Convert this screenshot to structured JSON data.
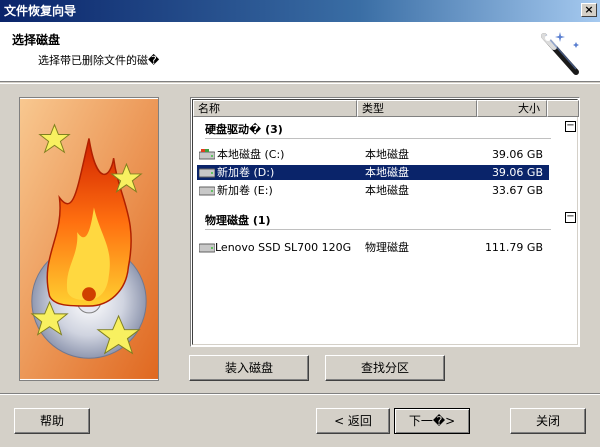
{
  "window": {
    "title": "文件恢复向导",
    "close_glyph": "×"
  },
  "header": {
    "title": "选择磁盘",
    "subtitle": "选择带已删除文件的磁�"
  },
  "list": {
    "columns": {
      "name": "名称",
      "type": "类型",
      "size": "大小"
    },
    "groups": [
      {
        "label": "硬盘驱动� (3)",
        "collapse": "−",
        "rows": [
          {
            "name": "本地磁盘 (C:)",
            "type": "本地磁盘",
            "size": "39.06 GB",
            "icon": "windows-drive-icon",
            "selected": false
          },
          {
            "name": "新加卷 (D:)",
            "type": "本地磁盘",
            "size": "39.06 GB",
            "icon": "drive-icon",
            "selected": true
          },
          {
            "name": "新加卷 (E:)",
            "type": "本地磁盘",
            "size": "33.67 GB",
            "icon": "drive-icon",
            "selected": false
          }
        ]
      },
      {
        "label": "物理磁盘 (1)",
        "collapse": "−",
        "rows": [
          {
            "name": "Lenovo SSD SL700 120G",
            "type": "物理磁盘",
            "size": "111.79 GB",
            "icon": "drive-icon",
            "selected": false
          }
        ]
      }
    ]
  },
  "buttons": {
    "mount": "装入磁盘",
    "find_partition": "查找分区",
    "help": "帮助",
    "back": "< 返回",
    "next": "下一�>",
    "close": "关闭"
  }
}
